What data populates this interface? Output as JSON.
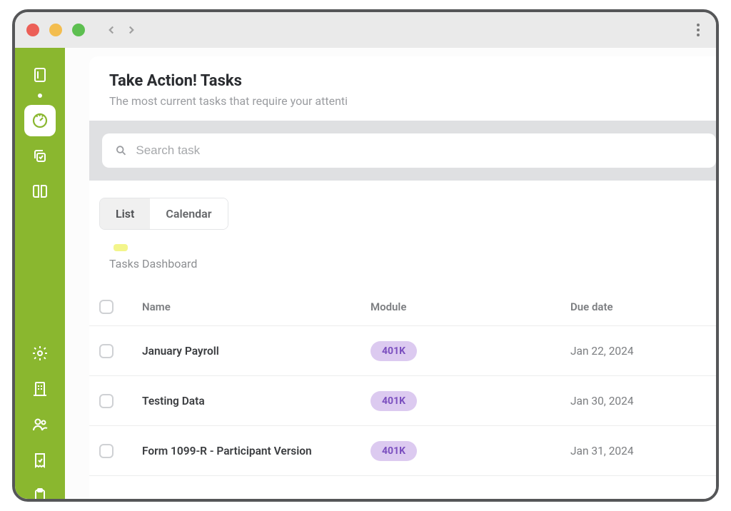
{
  "header": {
    "title": "Take Action! Tasks",
    "subtitle": "The most current tasks that require your attenti"
  },
  "search": {
    "placeholder": "Search task"
  },
  "tabs": [
    {
      "label": "List",
      "active": true
    },
    {
      "label": "Calendar",
      "active": false
    }
  ],
  "dashboard_label": "Tasks Dashboard",
  "columns": {
    "name": "Name",
    "module": "Module",
    "due": "Due date"
  },
  "rows": [
    {
      "name": "January Payroll",
      "module": "401K",
      "due": "Jan 22, 2024"
    },
    {
      "name": "Testing Data",
      "module": "401K",
      "due": "Jan 30, 2024"
    },
    {
      "name": "Form 1099-R - Participant Version",
      "module": "401K",
      "due": "Jan 31, 2024"
    }
  ],
  "sidebar_icons": [
    "book-icon",
    "gauge-icon",
    "copy-icon",
    "open-book-icon",
    "settings-icon",
    "building-icon",
    "users-icon",
    "receipt-icon",
    "clipboard-icon"
  ]
}
